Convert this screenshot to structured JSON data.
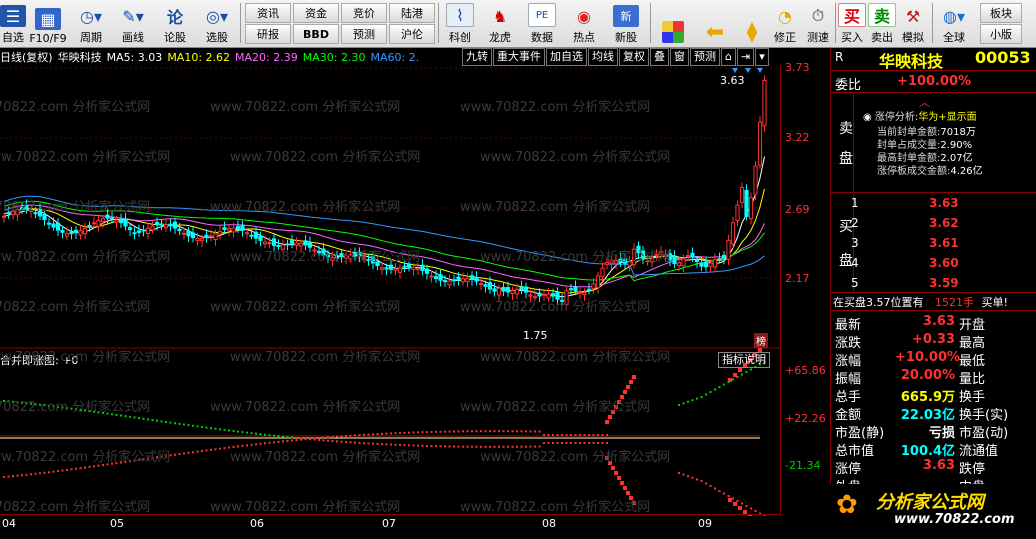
{
  "toolbar": {
    "buttons": [
      {
        "label": "自选",
        "icon": "star-list"
      },
      {
        "label": "F10/F9",
        "icon": "doc-icon"
      },
      {
        "label": "周期",
        "icon": "clock-icon"
      },
      {
        "label": "画线",
        "icon": "pencil-icon"
      },
      {
        "label": "论股",
        "icon": "chat-icon"
      },
      {
        "label": "选股",
        "icon": "filter-icon"
      }
    ],
    "box_buttons": [
      {
        "label": "资讯"
      },
      {
        "label": "资金"
      },
      {
        "label": "竞价"
      },
      {
        "label": "陆港"
      },
      {
        "label": "研报"
      },
      {
        "label": "BBD"
      },
      {
        "label": "预测"
      },
      {
        "label": "沪伦"
      }
    ],
    "icon_buttons": [
      {
        "label": "科创"
      },
      {
        "label": "龙虎"
      },
      {
        "label": "数据"
      },
      {
        "label": "热点"
      },
      {
        "label": "新股"
      }
    ],
    "right_buttons": [
      {
        "label": "修正"
      },
      {
        "label": "测速"
      },
      {
        "label": "买入"
      },
      {
        "label": "卖出"
      },
      {
        "label": "模拟"
      },
      {
        "label": "全球"
      }
    ],
    "small_boxes": [
      {
        "label": "板块"
      },
      {
        "label": "小版"
      }
    ]
  },
  "infobar": {
    "period": "日线(复权)",
    "name": "华映科技",
    "ma5": "MA5: 3.03",
    "ma10": "MA10: 2.62",
    "ma20": "MA20: 2.39",
    "ma30": "MA30: 2.30",
    "ma60": "MA60: 2."
  },
  "tabs": [
    "九转",
    "重大事件",
    "加自选",
    "均线",
    "复权",
    "叠",
    "窗",
    "预测"
  ],
  "yaxis": [
    "3.73",
    "3.22",
    "2.69",
    "2.17"
  ],
  "indicator": {
    "title": "合并即涨图: +0",
    "button": "指标说明",
    "levels": [
      "+65.86",
      "+22.26",
      "-21.34"
    ]
  },
  "annotations": {
    "high": "3.63",
    "low": "1.75",
    "bang": "榜"
  },
  "xaxis": [
    "04",
    "05",
    "06",
    "07",
    "08",
    "09"
  ],
  "watermark": "www.70822.com 分析家公式网",
  "sidebar": {
    "r_mark": "R",
    "title": "华映科技",
    "code": "00053",
    "weibi_label": "委比",
    "weibi": "+100.00%",
    "sell_label": "卖",
    "sell_label2": "盘",
    "buy_label": "买",
    "buy_label2": "盘",
    "zt_title": "涨停分析:",
    "zt_subtitle": "华为+显示面",
    "zt_items": [
      {
        "label": "当前封单金额:",
        "value": "7018万"
      },
      {
        "label": "封单占成交量:",
        "value": "2.90%"
      },
      {
        "label": "最高封单金额:",
        "value": "2.07亿"
      },
      {
        "label": "涨停板成交金额:",
        "value": "4.26亿"
      }
    ],
    "bids": [
      {
        "n": "1",
        "p": "3.63"
      },
      {
        "n": "2",
        "p": "3.62"
      },
      {
        "n": "3",
        "p": "3.61"
      },
      {
        "n": "4",
        "p": "3.60"
      },
      {
        "n": "5",
        "p": "3.59"
      }
    ],
    "queue_text": "在买盘3.57位置有",
    "queue_size": "1521手",
    "queue_tail": "买单!",
    "quote": [
      {
        "l": "最新",
        "v": "3.63",
        "t": "开盘"
      },
      {
        "l": "涨跌",
        "v": "+0.33",
        "t": "最高"
      },
      {
        "l": "涨幅",
        "v": "+10.00%",
        "t": "最低"
      },
      {
        "l": "振幅",
        "v": "20.00%",
        "t": "量比"
      },
      {
        "l": "总手",
        "v": "665.9万",
        "t": "换手"
      },
      {
        "l": "金额",
        "v": "22.03亿",
        "t": "换手(实)"
      },
      {
        "l": "市盈(静)",
        "v": "亏损",
        "t": "市盈(动)"
      },
      {
        "l": "总市值",
        "v": "100.4亿",
        "t": "流通值"
      },
      {
        "l": "涨停",
        "v": "3.63",
        "t": "跌停"
      },
      {
        "l": "外盘",
        "v": "",
        "t": "内盘"
      }
    ],
    "logo_text": "分析家公式网",
    "logo_url": "www.70822.com"
  },
  "colors": {
    "up": "#ff3030",
    "down": "#00ffff",
    "ma5": "#ffffff",
    "ma10": "#ffff00",
    "ma20": "#ff66ff",
    "ma30": "#00ff00",
    "ma60": "#3399ff"
  }
}
